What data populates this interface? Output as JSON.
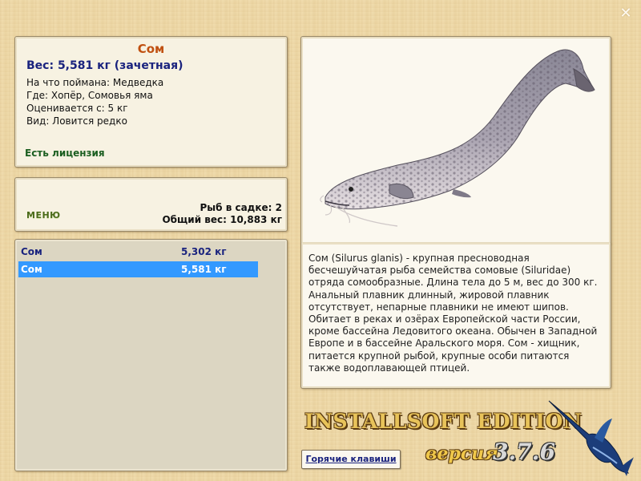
{
  "window": {
    "close_glyph": "✕"
  },
  "fish": {
    "title": "Сом",
    "weight_line": "Вес: 5,581 кг (зачетная)",
    "caught_with": "На что поймана: Медведка",
    "location": "Где: Хопёр, Сомовья яма",
    "valued_from": "Оценивается с: 5 кг",
    "kind": "Вид: Ловится редко",
    "license": "Есть лицензия"
  },
  "menu": {
    "menu_label": "МЕНЮ",
    "fish_in_cage": "Рыб в садке: 2",
    "total_weight": "Общий вес: 10,883 кг"
  },
  "catch_list": [
    {
      "name": "Сом",
      "weight": "5,302 кг",
      "selected": false
    },
    {
      "name": "Сом",
      "weight": "5,581 кг",
      "selected": true
    }
  ],
  "description": "Сом (Silurus glanis) - крупная пресноводная бесчешуйчатая рыба семейства сомовые (Siluridae) отряда сомообразные. Длина тела до 5 м, вес до 300 кг. Анальный плавник длинный, жировой плавник отсутствует, непарные плавники не имеют шипов. Обитает в реках и озёрах Европейской части России, кроме бассейна Ледовитого океана. Обычен в Западной Европе и в бассейне Аральского моря. Сом - хищник, питается крупной рыбой, крупные особи питаются также водоплавающей птицей.",
  "brand": {
    "title": "INSTALLSOFT EDITION",
    "version_label": "версия",
    "version_number": "3.7.6"
  },
  "hotkeys_label": "Горячие клавиши",
  "icons": {
    "close": "close-icon",
    "fish_image": "catfish-image",
    "logo": "marlin-logo"
  }
}
